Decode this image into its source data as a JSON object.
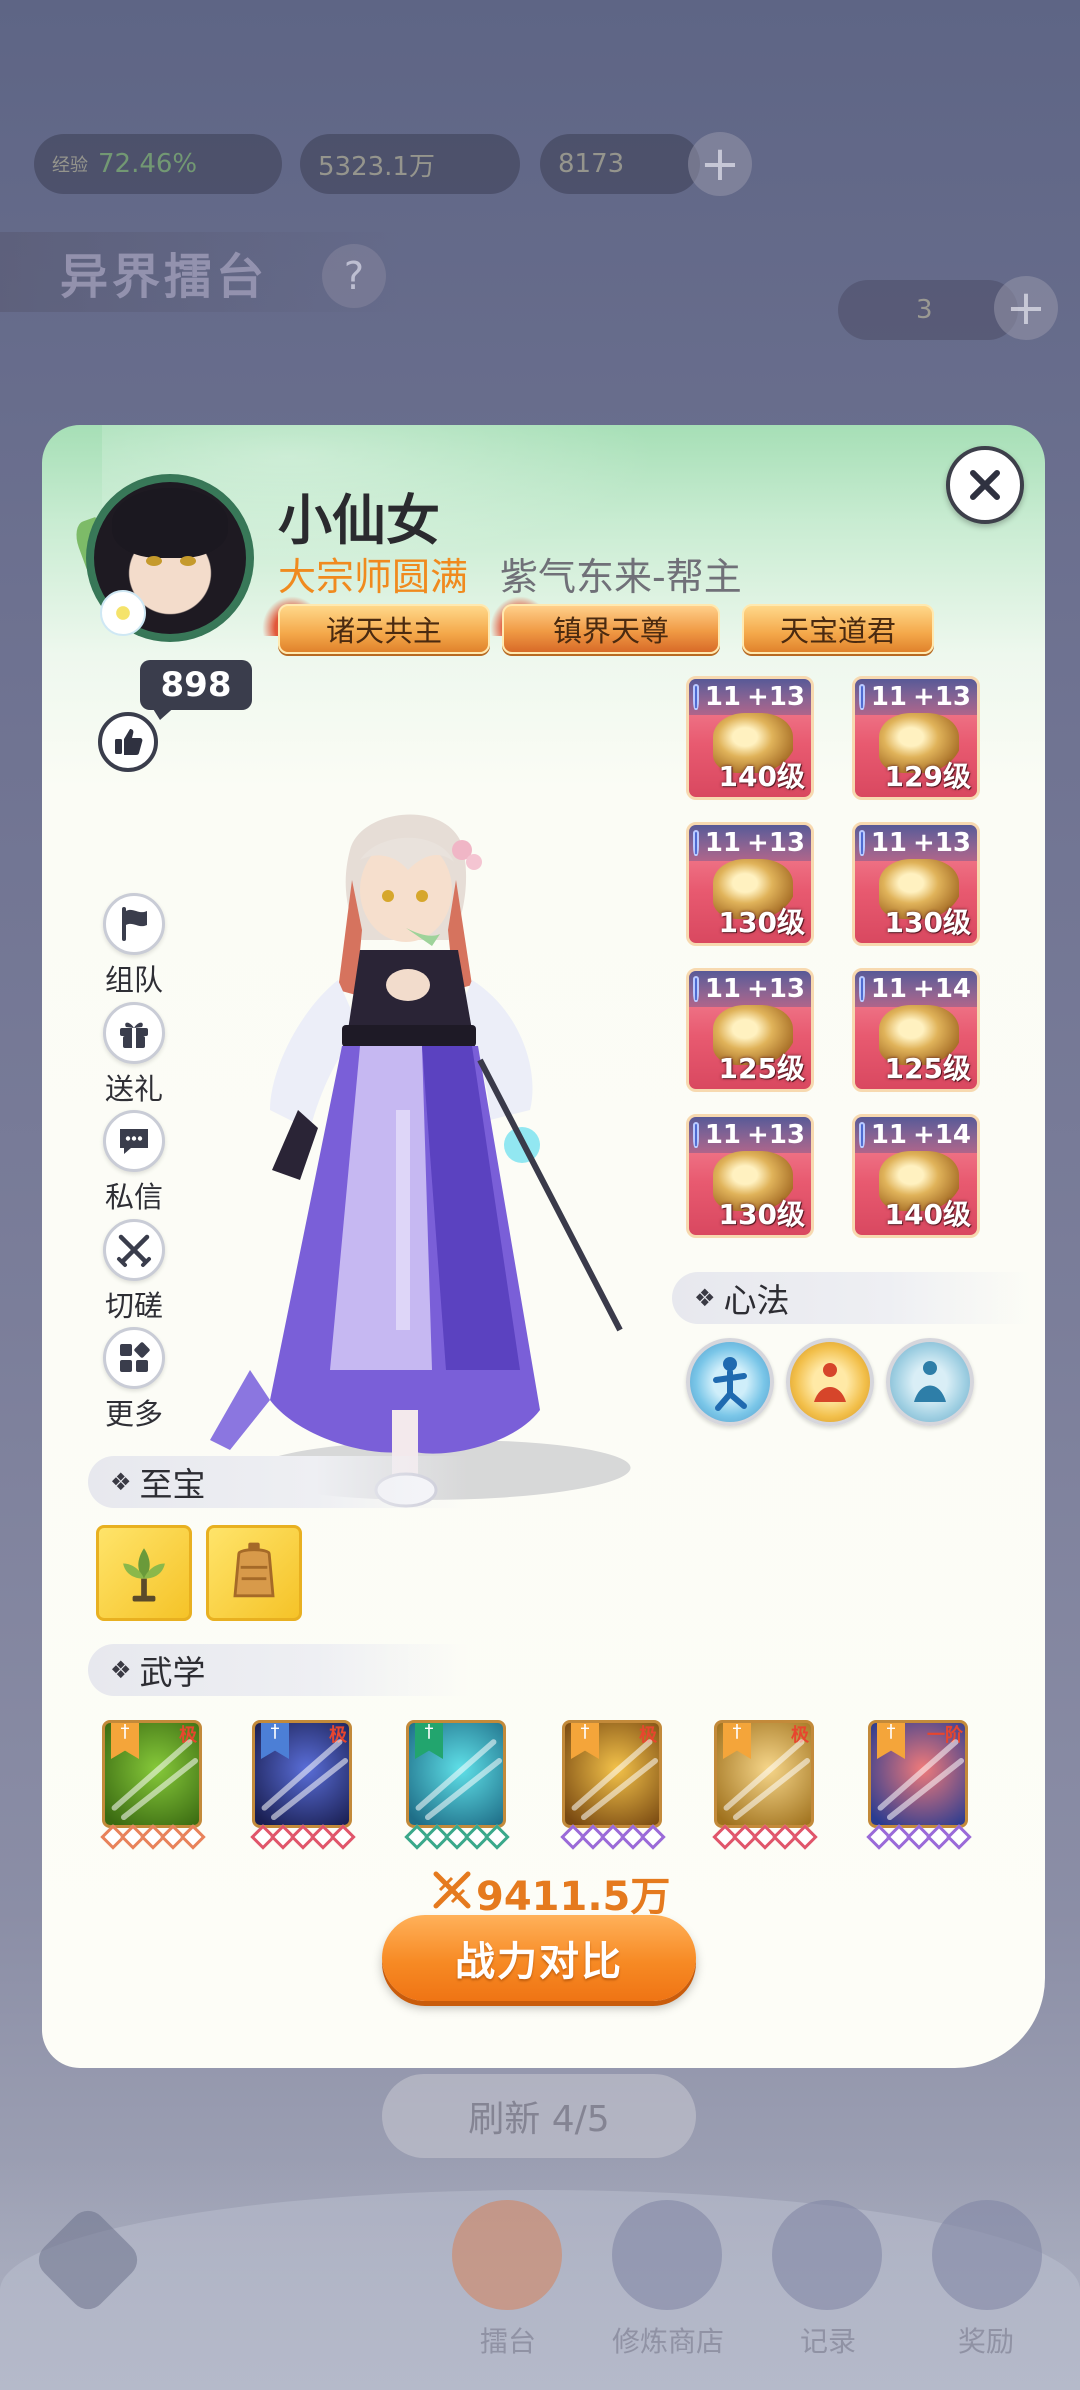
{
  "background": {
    "top_bar": {
      "exp_label": "经验",
      "exp_value": "72.46%",
      "currency_value": "5323.1万",
      "ticket_value": "8173"
    },
    "page_title": "异界擂台",
    "help_symbol": "?",
    "stamina_value": "3",
    "refresh_label": "刷新 4/5",
    "nav": [
      "擂台",
      "修炼商店",
      "记录",
      "奖励"
    ]
  },
  "player": {
    "name": "小仙女",
    "rank": "大宗师圆满",
    "guild": "紫气东来-帮主",
    "titles": [
      "诸天共主",
      "镇界天尊",
      "天宝道君"
    ],
    "likes": "898"
  },
  "actions": [
    {
      "label": "组队",
      "icon": "flag-icon"
    },
    {
      "label": "送礼",
      "icon": "gift-icon"
    },
    {
      "label": "私信",
      "icon": "chat-icon"
    },
    {
      "label": "切磋",
      "icon": "crossed-swords-icon"
    },
    {
      "label": "更多",
      "icon": "more-grid-icon"
    }
  ],
  "equipment": [
    {
      "tier": "11",
      "plus": "+13",
      "level": "140级",
      "type": "weapon"
    },
    {
      "tier": "11",
      "plus": "+13",
      "level": "129级",
      "type": "helmet"
    },
    {
      "tier": "11",
      "plus": "+13",
      "level": "130级",
      "type": "armor"
    },
    {
      "tier": "11",
      "plus": "+13",
      "level": "130级",
      "type": "pants"
    },
    {
      "tier": "11",
      "plus": "+13",
      "level": "125级",
      "type": "boots"
    },
    {
      "tier": "11",
      "plus": "+14",
      "level": "125级",
      "type": "greaves"
    },
    {
      "tier": "11",
      "plus": "+13",
      "level": "130级",
      "type": "ring"
    },
    {
      "tier": "11",
      "plus": "+14",
      "level": "140级",
      "type": "amulet"
    }
  ],
  "sections": {
    "heart_method": "心法",
    "treasures": "至宝",
    "martial_arts": "武学"
  },
  "heart_methods": [
    "martial-pose-icon",
    "fire-meditation-icon",
    "water-meditation-icon"
  ],
  "treasures": [
    "lotus-treasure-icon",
    "bell-treasure-icon"
  ],
  "martial_skills": [
    {
      "ribbon": "gold",
      "grade": "极",
      "colors": [
        "#86c93a",
        "#3b6b12"
      ],
      "pip_color": "#e8825a"
    },
    {
      "ribbon": "blue",
      "grade": "极",
      "colors": [
        "#5a6ed8",
        "#1a1f52"
      ],
      "pip_color": "#e0556a"
    },
    {
      "ribbon": "teal",
      "grade": "",
      "colors": [
        "#5fe0e8",
        "#1f6e88"
      ],
      "pip_color": "#3aa88a"
    },
    {
      "ribbon": "gold",
      "grade": "极",
      "colors": [
        "#f3c24a",
        "#7a4a12"
      ],
      "pip_color": "#9a6ad8"
    },
    {
      "ribbon": "gold",
      "grade": "极",
      "colors": [
        "#f6d68a",
        "#a0721e"
      ],
      "pip_color": "#e0556a"
    },
    {
      "ribbon": "gold",
      "grade": "一阶",
      "colors": [
        "#f07a7a",
        "#2a3c90"
      ],
      "pip_color": "#9a6ad8"
    }
  ],
  "power": {
    "value": "9411.5万",
    "compare_label": "战力对比"
  },
  "colors": {
    "accent_orange": "#f08a1e",
    "panel_green": "#a6dfb6",
    "equip_red": "#e85a70"
  }
}
